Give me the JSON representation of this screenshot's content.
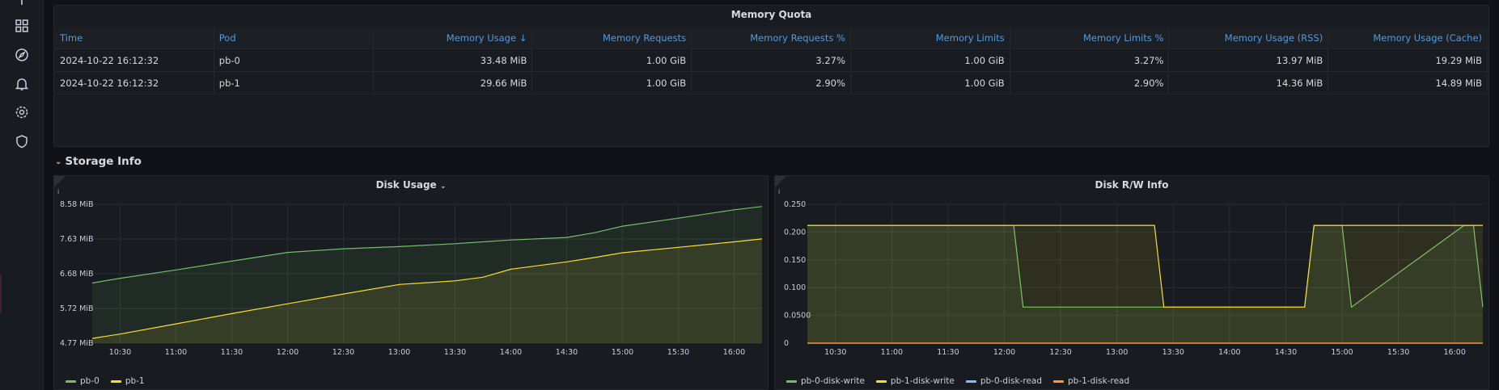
{
  "memory_quota": {
    "title": "Memory Quota",
    "columns": [
      "Time",
      "Pod",
      "Memory Usage",
      "Memory Requests",
      "Memory Requests %",
      "Memory Limits",
      "Memory Limits %",
      "Memory Usage (RSS)",
      "Memory Usage (Cache)"
    ],
    "sort_indicator": "↓",
    "rows": [
      [
        "2024-10-22 16:12:32",
        "pb-0",
        "33.48 MiB",
        "1.00 GiB",
        "3.27%",
        "1.00 GiB",
        "3.27%",
        "13.97 MiB",
        "19.29 MiB"
      ],
      [
        "2024-10-22 16:12:32",
        "pb-1",
        "29.66 MiB",
        "1.00 GiB",
        "2.90%",
        "1.00 GiB",
        "2.90%",
        "14.36 MiB",
        "14.89 MiB"
      ]
    ]
  },
  "row": {
    "title": "Storage Info",
    "chevron": "⌄"
  },
  "disk_usage": {
    "title": "Disk Usage",
    "title_chevron": "⌄",
    "info": "i"
  },
  "disk_rw": {
    "title": "Disk R/W Info",
    "info": "i"
  },
  "sidebar": {
    "icons": [
      "plus-icon",
      "dashboards-icon",
      "explore-icon",
      "alerting-icon",
      "configuration-icon",
      "server-admin-icon"
    ]
  },
  "colors": {
    "background": "#111217",
    "panel": "#181b1f",
    "header_link": "#4d9de6",
    "green": "#73bf69",
    "yellow": "#fade2a",
    "blue": "#8ab8ff",
    "orange": "#ff9830"
  },
  "chart_data": [
    {
      "type": "area",
      "title": "Disk Usage",
      "x_ticks": [
        "10:30",
        "11:00",
        "11:30",
        "12:00",
        "12:30",
        "13:00",
        "13:30",
        "14:00",
        "14:30",
        "15:00",
        "15:30",
        "16:00"
      ],
      "y_ticks": [
        "4.77 MiB",
        "5.72 MiB",
        "6.68 MiB",
        "7.63 MiB",
        "8.58 MiB"
      ],
      "ylim": [
        4.77,
        8.58
      ],
      "x": [
        "10:15",
        "10:30",
        "11:00",
        "11:30",
        "12:00",
        "12:30",
        "13:00",
        "13:30",
        "13:45",
        "14:00",
        "14:30",
        "14:45",
        "15:00",
        "15:30",
        "16:00",
        "16:15"
      ],
      "series": [
        {
          "name": "pb-0",
          "color": "#73bf69",
          "values": [
            6.42,
            6.55,
            6.78,
            7.02,
            7.26,
            7.36,
            7.42,
            7.5,
            7.55,
            7.6,
            7.67,
            7.8,
            7.98,
            8.2,
            8.43,
            8.52
          ]
        },
        {
          "name": "pb-1",
          "color": "#fade2a",
          "values": [
            4.9,
            5.02,
            5.3,
            5.58,
            5.85,
            6.12,
            6.38,
            6.48,
            6.58,
            6.8,
            7.0,
            7.12,
            7.25,
            7.4,
            7.55,
            7.63
          ]
        }
      ],
      "legend": "bottom-left",
      "grid": true
    },
    {
      "type": "line",
      "title": "Disk R/W Info",
      "x_ticks": [
        "10:30",
        "11:00",
        "11:30",
        "12:00",
        "12:30",
        "13:00",
        "13:30",
        "14:00",
        "14:30",
        "15:00",
        "15:30",
        "16:00"
      ],
      "y_ticks": [
        "0",
        "0.0500",
        "0.100",
        "0.150",
        "0.200",
        "0.250"
      ],
      "ylim": [
        0,
        0.25
      ],
      "x": [
        "10:15",
        "12:05",
        "12:10",
        "13:20",
        "13:25",
        "14:40",
        "14:45",
        "15:00",
        "15:05",
        "16:05",
        "16:10",
        "16:15"
      ],
      "series": [
        {
          "name": "pb-0-disk-write",
          "color": "#73bf69",
          "values": [
            0.212,
            0.212,
            0.065,
            0.065,
            0.065,
            0.065,
            0.212,
            0.212,
            0.065,
            0.212,
            0.212,
            0.065
          ]
        },
        {
          "name": "pb-1-disk-write",
          "color": "#fade2a",
          "values": [
            0.212,
            0.212,
            0.212,
            0.212,
            0.065,
            0.065,
            0.212,
            0.212,
            0.212,
            0.212,
            0.212,
            0.212
          ]
        },
        {
          "name": "pb-0-disk-read",
          "color": "#8ab8ff",
          "values": [
            0,
            0,
            0,
            0,
            0,
            0,
            0,
            0,
            0,
            0,
            0,
            0
          ]
        },
        {
          "name": "pb-1-disk-read",
          "color": "#ff9830",
          "values": [
            0,
            0,
            0,
            0,
            0,
            0,
            0,
            0,
            0,
            0,
            0,
            0
          ]
        }
      ],
      "legend": "bottom-left",
      "grid": true
    }
  ]
}
